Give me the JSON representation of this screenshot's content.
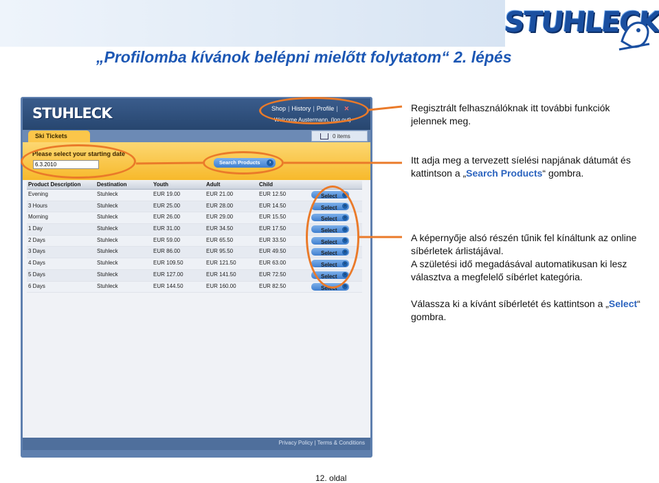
{
  "slide": {
    "title": "„Profilomba kívánok belépni mielőtt folytatom“ 2. lépés",
    "brand": "STUHLECK",
    "page_number": "12. oldal"
  },
  "app": {
    "logo": "STUHLECK",
    "nav": [
      "Shop",
      "History",
      "Profile"
    ],
    "nav_close": "✕",
    "user_line": "Welcome Austermann. (log out)",
    "tab": "Ski Tickets",
    "cart": "0 items",
    "search_label": "Please select your starting date",
    "date_value": "6.3.2010",
    "search_button": "Search Products",
    "columns": [
      "Product Description",
      "Destination",
      "Youth",
      "Adult",
      "Child"
    ],
    "select_label": "Select",
    "rows": [
      {
        "product": "Evening",
        "destination": "Stuhleck",
        "youth": "EUR 19.00",
        "adult": "EUR 21.00",
        "child": "EUR 12.50"
      },
      {
        "product": "3 Hours",
        "destination": "Stuhleck",
        "youth": "EUR 25.00",
        "adult": "EUR 28.00",
        "child": "EUR 14.50"
      },
      {
        "product": "Morning",
        "destination": "Stuhleck",
        "youth": "EUR 26.00",
        "adult": "EUR 29.00",
        "child": "EUR 15.50"
      },
      {
        "product": "1 Day",
        "destination": "Stuhleck",
        "youth": "EUR 31.00",
        "adult": "EUR 34.50",
        "child": "EUR 17.50"
      },
      {
        "product": "2 Days",
        "destination": "Stuhleck",
        "youth": "EUR 59.00",
        "adult": "EUR 65.50",
        "child": "EUR 33.50"
      },
      {
        "product": "3 Days",
        "destination": "Stuhleck",
        "youth": "EUR 86.00",
        "adult": "EUR 95.50",
        "child": "EUR 49.50"
      },
      {
        "product": "4 Days",
        "destination": "Stuhleck",
        "youth": "EUR 109.50",
        "adult": "EUR 121.50",
        "child": "EUR 63.00"
      },
      {
        "product": "5 Days",
        "destination": "Stuhleck",
        "youth": "EUR 127.00",
        "adult": "EUR 141.50",
        "child": "EUR 72.50"
      },
      {
        "product": "6 Days",
        "destination": "Stuhleck",
        "youth": "EUR 144.50",
        "adult": "EUR 160.00",
        "child": "EUR 82.50"
      }
    ],
    "footer": "Privacy Policy | Terms & Conditions"
  },
  "annotations": {
    "a1": "Regisztrált felhasználóknak itt további funkciók jelennek meg.",
    "a2_pre": "Itt adja meg a tervezett síelési napjának dátumát és  kattintson a „",
    "a2_hl": "Search Products",
    "a2_post": "“ gombra.",
    "a3_line1": "A képernyője alsó részén tűnik fel kínáltunk az online síbérletek árlistájával.",
    "a3_line2": "A születési idő megadásával automatikusan ki lesz választva a megfelelő síbérlet kategória.",
    "a4_pre": "Válassza ki a kívánt síbérletét és kattintson a „",
    "a4_hl": "Select",
    "a4_post": "“ gombra."
  },
  "colors": {
    "accent_orange": "#ea7a29",
    "title_blue": "#1c57b4",
    "highlight_blue": "#2b63bf"
  }
}
